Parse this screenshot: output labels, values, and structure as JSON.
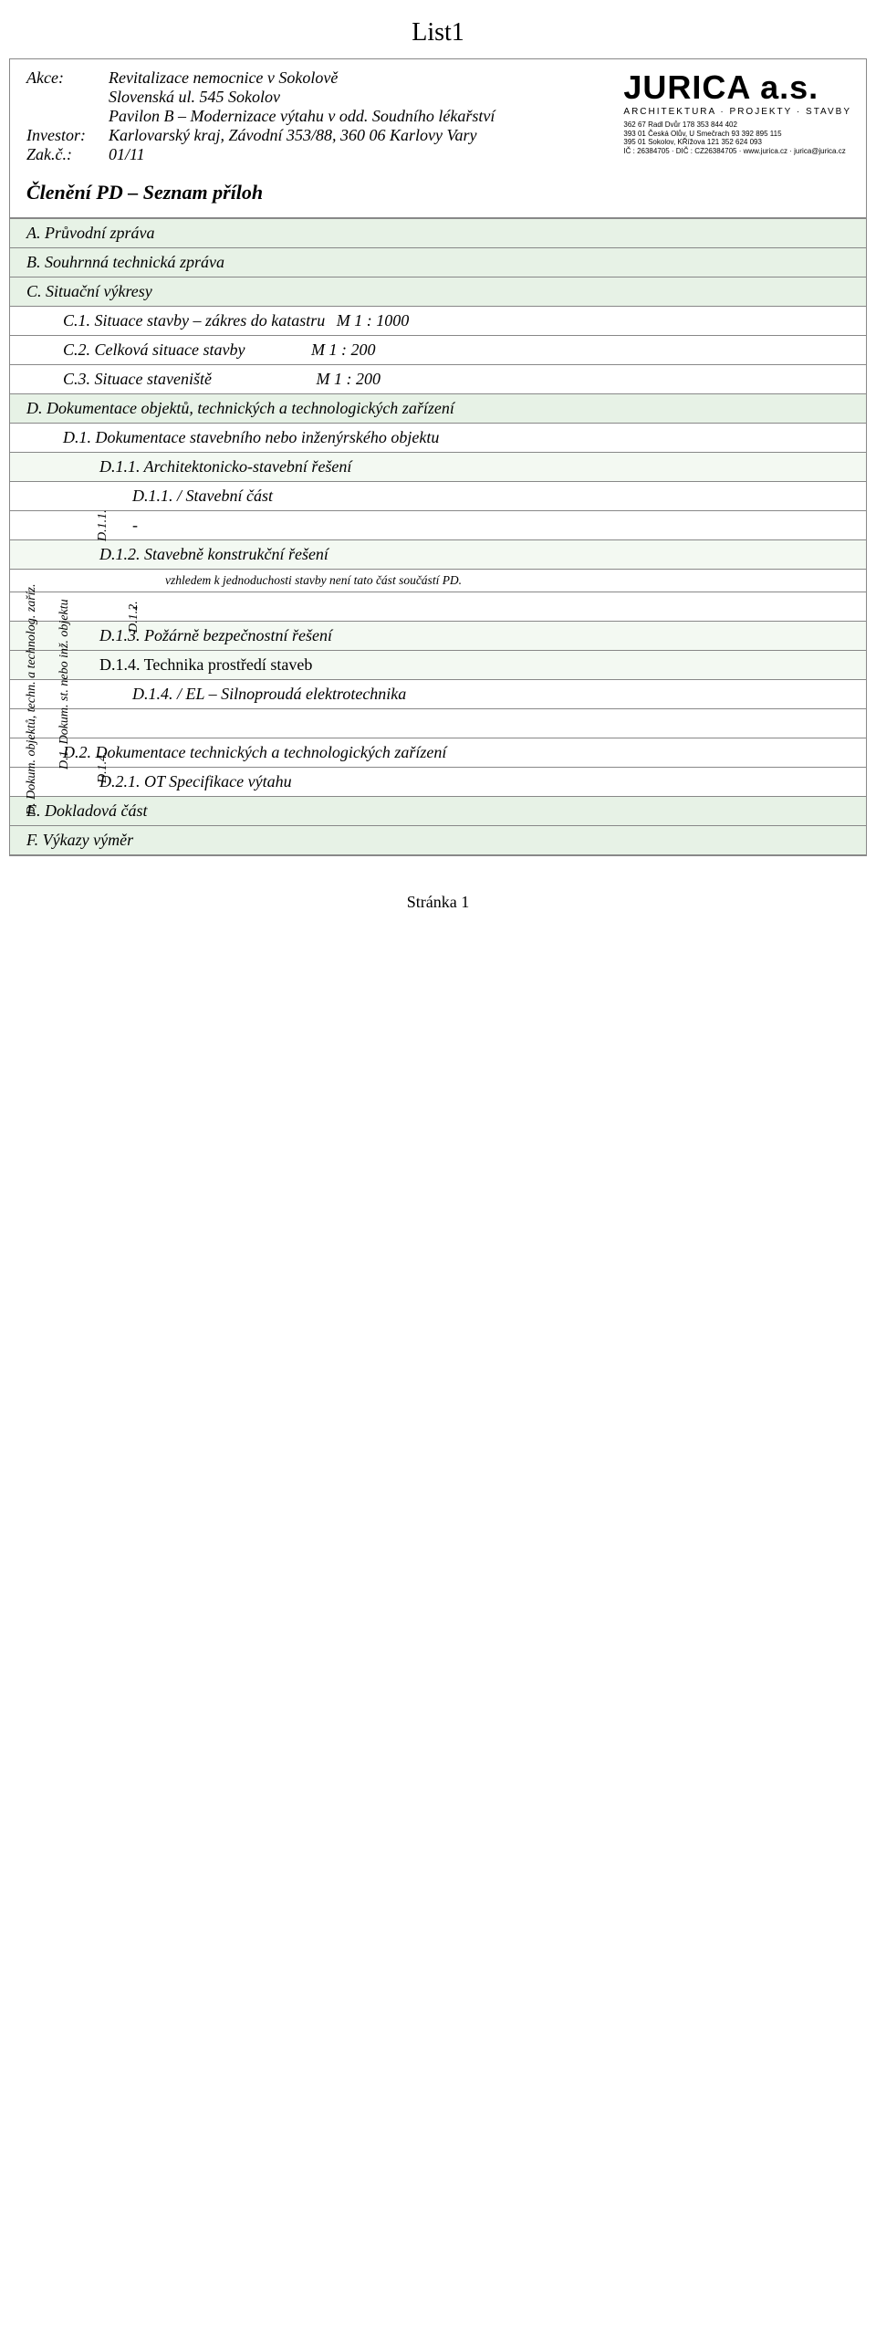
{
  "sheet_title": "List1",
  "header": {
    "akce_label": "Akce:",
    "akce_line1": "Revitalizace nemocnice v Sokolově",
    "akce_line2": "Slovenská ul. 545 Sokolov",
    "akce_line3": "Pavilon B – Modernizace výtahu v odd. Soudního lékařství",
    "investor_label": "Investor:",
    "investor": "Karlovarský kraj, Závodní 353/88, 360 06 Karlovy Vary",
    "zak_label": "Zak.č.:",
    "zak": "01/11",
    "subtitle": "Členění PD – Seznam příloh"
  },
  "logo": {
    "name": "JURICA a.s.",
    "sub": "ARCHITEKTURA · PROJEKTY · STAVBY",
    "addr1": "362 67 Radl Dvůr 178    353 844 402",
    "addr2": "393 01 Česká Olův, U Smečrach 93    392 895 115",
    "addr3": "395 01 Sokolov, KŘížova 121    352 624 093",
    "addr4": "IČ : 26384705 · DIČ : CZ26384705 · www.jurica.cz · jurica@jurica.cz"
  },
  "sections": {
    "A": "A. Průvodní zpráva",
    "B": "B. Souhrnná technická zpráva",
    "C": "C. Situační výkresy",
    "C1": "C.1. Situace stavby – zákres do katastru",
    "C1s": "M 1 : 1000",
    "C2": "C.2. Celková situace stavby",
    "C2s": "M 1 : 200",
    "C3": "C.3. Situace staveniště",
    "C3s": "M 1 : 200",
    "D": "D. Dokumentace objektů, technických a technologických zařízení",
    "D_vert": "D. Dokum. objektů, techn. a technolog. zaříz.",
    "D1": "D.1. Dokumentace stavebního nebo inženýrského objektu",
    "D1_vert": "D.1. Dokum. st. nebo inž. objektu",
    "D11": "D.1.1. Architektonicko-stavební řešení",
    "D11_vert": "D.1.1.",
    "D111": "D.1.1. / Stavební část",
    "dash1": "-",
    "D12": "D.1.2. Stavebně konstrukční řešení",
    "D12_vert": "D.1.2.",
    "D12note": "vzhledem k jednoduchosti stavby není tato část součástí PD.",
    "dash2": "-",
    "D13": "D.1.3. Požárně bezpečnostní řešení",
    "D14": "D.1.4. Technika prostředí staveb",
    "D14_vert": "D.1.4.",
    "D14EL": "D.1.4. / EL – Silnoproudá elektrotechnika",
    "D2": "D.2. Dokumentace technických a technologických zařízení",
    "D21": "D.2.1. OT Specifikace výtahu",
    "E": "E. Dokladová část",
    "F": "F. Výkazy výměr"
  },
  "footer": "Stránka 1"
}
